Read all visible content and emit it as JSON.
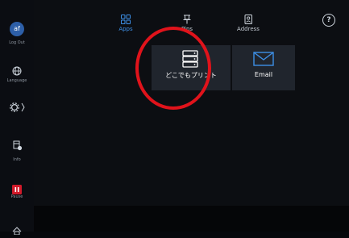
{
  "sidebar": {
    "avatar_initials": "af",
    "logout_label": "Log Out",
    "language_label": "Language",
    "info_label": "Info",
    "pause_label": "Pause"
  },
  "topnav": {
    "apps_label": "Apps",
    "pins_label": "Pins",
    "address_label": "Address",
    "help_symbol": "?"
  },
  "tiles": [
    {
      "label": "どこでもプリント",
      "icon": "printer-icon"
    },
    {
      "label": "Email",
      "icon": "envelope-icon"
    }
  ],
  "colors": {
    "accent": "#3d8fe6",
    "annotation_ring": "#e0131b",
    "pause_red": "#d11a2a",
    "tile_bg": "#20252d"
  }
}
